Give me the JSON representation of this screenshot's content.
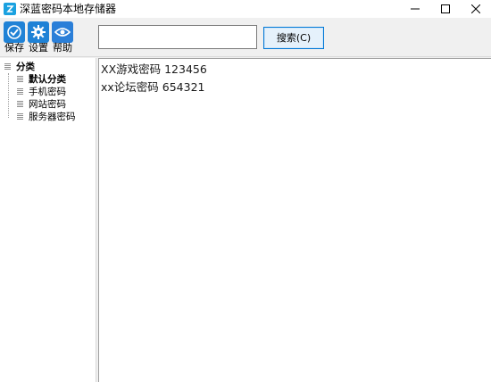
{
  "window": {
    "title": "深蓝密码本地存储器",
    "controls": [
      "minimize",
      "maximize",
      "close"
    ]
  },
  "toolbar": {
    "buttons": [
      {
        "label": "保存",
        "icon": "check-icon"
      },
      {
        "label": "设置",
        "icon": "gear-icon"
      },
      {
        "label": "帮助",
        "icon": "eye-icon"
      }
    ],
    "search": {
      "value": "",
      "placeholder": ""
    },
    "search_button": "搜索(C)"
  },
  "sidebar": {
    "root": {
      "label": "分类"
    },
    "items": [
      {
        "label": "默认分类",
        "selected": true
      },
      {
        "label": "手机密码",
        "selected": false
      },
      {
        "label": "网站密码",
        "selected": false
      },
      {
        "label": "服务器密码",
        "selected": false
      }
    ]
  },
  "content": {
    "entries": [
      "XX游戏密码 123456",
      "xx论坛密码 654321"
    ]
  },
  "colors": {
    "accent": "#1f82d6",
    "button_border": "#0078d7",
    "button_bg": "#e5f1fb"
  }
}
